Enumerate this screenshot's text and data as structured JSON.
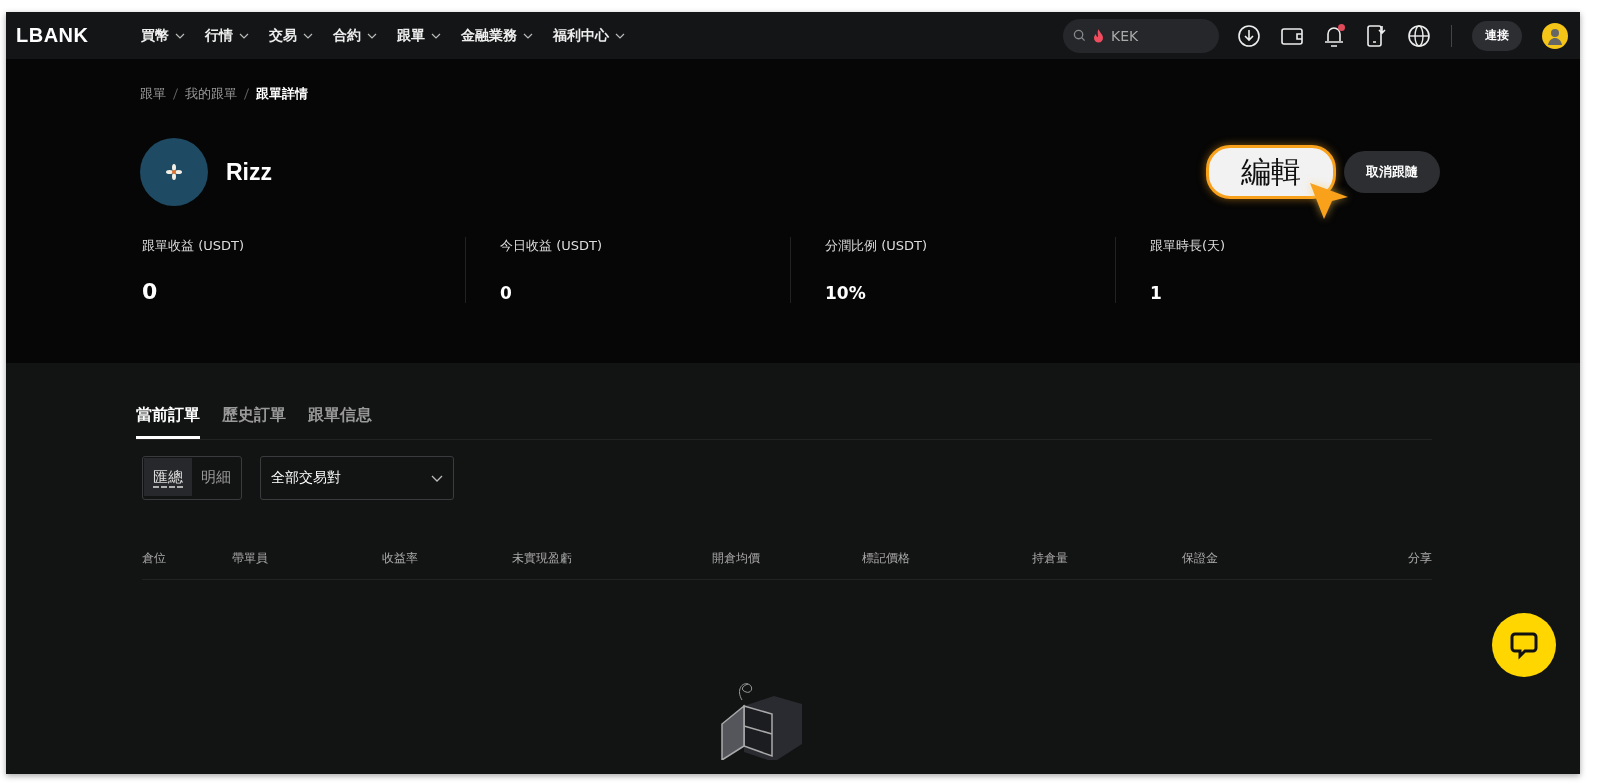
{
  "nav": {
    "logo": "LBANK",
    "menu": [
      {
        "label": "買幣"
      },
      {
        "label": "行情"
      },
      {
        "label": "交易"
      },
      {
        "label": "合約"
      },
      {
        "label": "跟單"
      },
      {
        "label": "金融業務"
      },
      {
        "label": "福利中心"
      }
    ],
    "search": {
      "placeholder": "KEK"
    },
    "notification_dot": true,
    "connect_button": "連接"
  },
  "breadcrumb": [
    {
      "label": "跟單",
      "current": false
    },
    {
      "label": "我的跟單",
      "current": false
    },
    {
      "label": "跟單詳情",
      "current": true
    }
  ],
  "profile": {
    "name": "Rizz",
    "edit_callout": "編輯",
    "unfollow_button": "取消跟隨"
  },
  "stats": [
    {
      "label": "跟單收益 (USDT)",
      "value": "0"
    },
    {
      "label": "今日收益 (USDT)",
      "value": "0"
    },
    {
      "label": "分潤比例 (USDT)",
      "value": "10%"
    },
    {
      "label": "跟單時長(天)",
      "value": "1"
    }
  ],
  "tabs": [
    {
      "label": "當前訂單",
      "selected": true
    },
    {
      "label": "歷史訂單",
      "selected": false
    },
    {
      "label": "跟單信息",
      "selected": false
    }
  ],
  "view_toggle": [
    {
      "label": "匯總",
      "selected": true
    },
    {
      "label": "明細",
      "selected": false
    }
  ],
  "pair_filter": {
    "value": "全部交易對"
  },
  "table": {
    "columns": [
      "倉位",
      "帶單員",
      "收益率",
      "未實現盈虧",
      "開倉均價",
      "標記價格",
      "持倉量",
      "保證金",
      "分享"
    ]
  }
}
